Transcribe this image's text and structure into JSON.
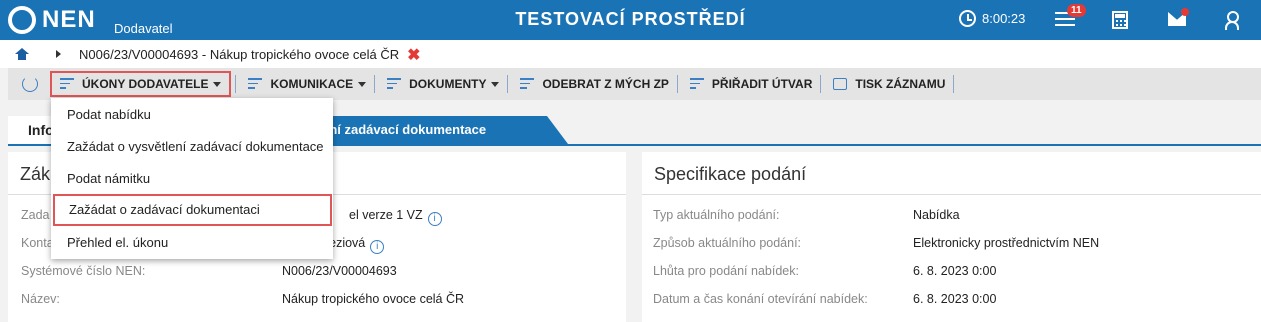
{
  "header": {
    "logo_text": "NEN",
    "logo_sub": "Dodavatel",
    "env_title": "TESTOVACÍ PROSTŘEDÍ",
    "clock": "8:00:23",
    "notifications_count": "11"
  },
  "breadcrumb": {
    "text": "N006/23/V00004693 - Nákup tropického ovoce celá ČR",
    "close": "✖"
  },
  "toolbar": {
    "ukony": "ÚKONY DODAVATELE",
    "komunikace": "KOMUNIKACE",
    "dokumenty": "DOKUMENTY",
    "odebrat": "ODEBRAT Z MÝCH ZP",
    "priradit": "PŘIŘADIT ÚTVAR",
    "tisk": "TISK ZÁZNAMU"
  },
  "dropdown": {
    "items": [
      "Podat nabídku",
      "Zažádat o vysvětlení zadávací dokumentace",
      "Podat námitku",
      "Zažádat o zadávací dokumentaci",
      "Přehled el. úkonu"
    ]
  },
  "tabs": {
    "info": "Info",
    "active": "vysvětlení zadávací dokumentace"
  },
  "left_panel": {
    "title": "Zák",
    "rows": [
      {
        "label": "Zada",
        "value": "el verze 1 VZ"
      },
      {
        "label": "Konta",
        "value": "ereziová"
      },
      {
        "label": "Systémové číslo NEN:",
        "value": "N006/23/V00004693"
      },
      {
        "label": "Název:",
        "value": "Nákup tropického ovoce celá ČR"
      }
    ]
  },
  "right_panel": {
    "title": "Specifikace podání",
    "rows": [
      {
        "label": "Typ aktuálního podání:",
        "value": "Nabídka"
      },
      {
        "label": "Způsob aktuálního podání:",
        "value": "Elektronicky prostřednictvím NEN"
      },
      {
        "label": "Lhůta pro podání nabídek:",
        "value": "6. 8. 2023 0:00"
      },
      {
        "label": "Datum a čas konání otevírání nabídek:",
        "value": "6. 8. 2023 0:00"
      }
    ]
  },
  "colors": {
    "brand": "#1a73b5",
    "highlight": "#e05555"
  }
}
